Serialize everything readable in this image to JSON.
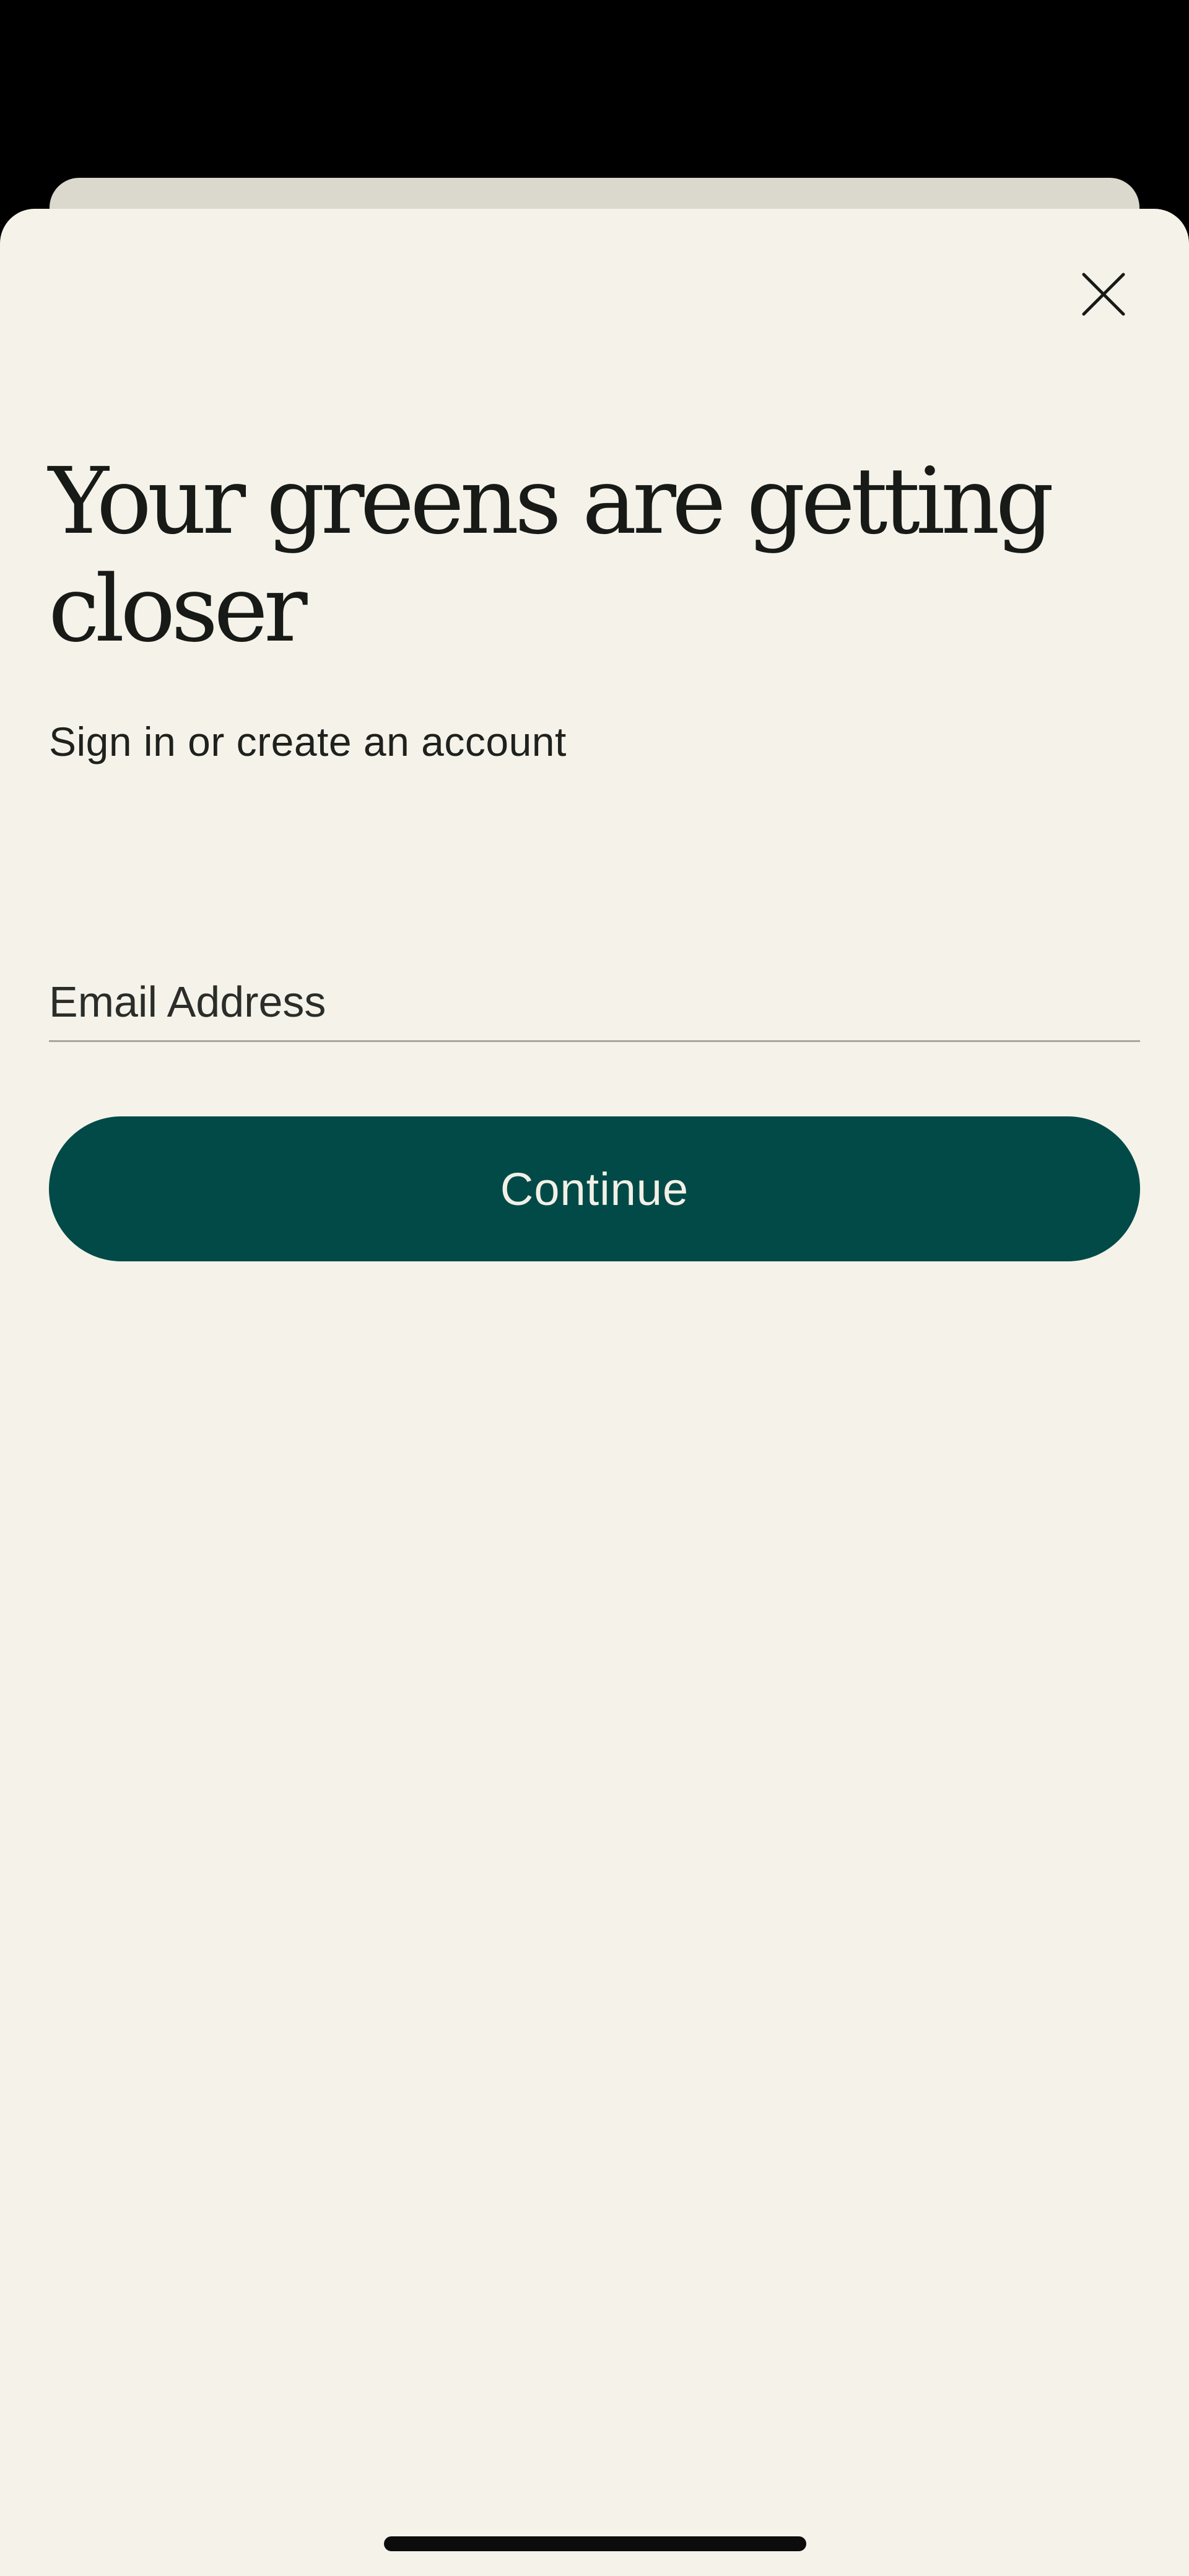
{
  "sheet": {
    "title": "Your greens are getting closer",
    "subtitle": "Sign in or create an account",
    "close_icon": "close-icon"
  },
  "form": {
    "email_placeholder": "Email Address",
    "email_value": "",
    "continue_label": "Continue"
  },
  "colors": {
    "background": "#F5F3E9",
    "primary_button": "#014A48",
    "button_text": "#F2F0E6",
    "text": "#171A16",
    "stacked_card": "#DBD9CE"
  }
}
